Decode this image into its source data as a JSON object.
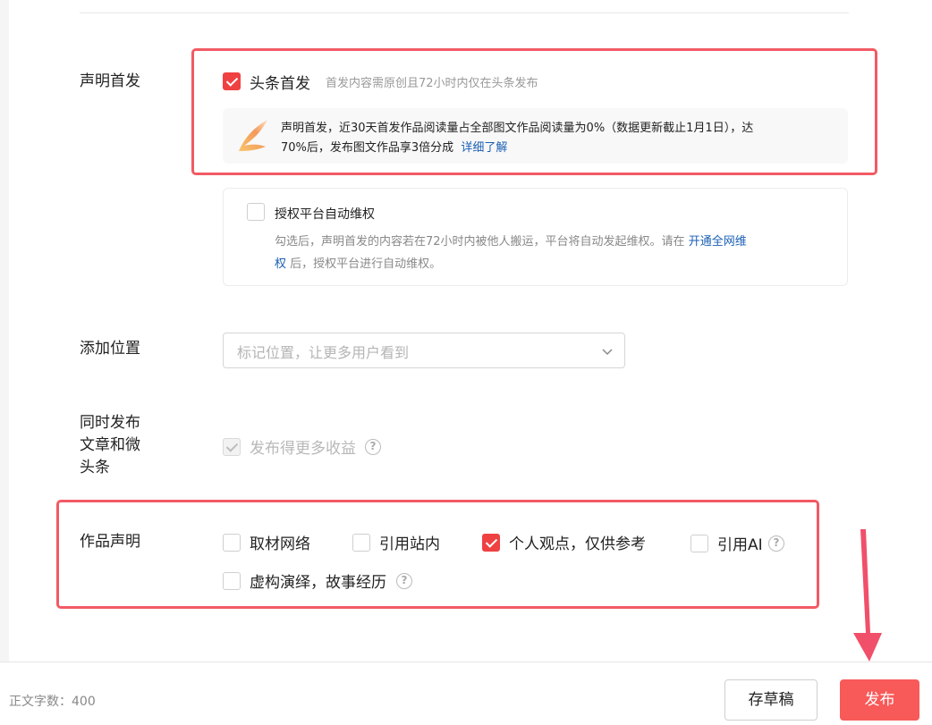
{
  "first_publish": {
    "label": "声明首发",
    "checkbox_label": "头条首发",
    "checkbox_hint": "首发内容需原创且72小时内仅在头条发布",
    "checked": true,
    "notice_line1": "声明首发，近30天首发作品阅读量占全部图文作品阅读量为0%（数据更新截止1月1日），达",
    "notice_line2": "70%后，发布图文作品享3倍分成",
    "notice_link": "详细了解"
  },
  "auth_rights": {
    "title": "授权平台自动维权",
    "checked": false,
    "desc_line1": "勾选后，声明首发的内容若在72小时内被他人搬运，平台将自动发起维权。请在",
    "link_part1": "开通全网维",
    "link_part2": "权",
    "desc_line2": "后，授权平台进行自动维权。"
  },
  "location": {
    "label": "添加位置",
    "placeholder": "标记位置，让更多用户看到",
    "dropdown_icon": "chevron-down-icon"
  },
  "sync_publish": {
    "label_line1": "同时发布",
    "label_line2": "文章和微",
    "label_line3": "头条",
    "checkbox_label": "发布得更多收益",
    "checked": true,
    "disabled": true
  },
  "declaration": {
    "label": "作品声明",
    "options": [
      {
        "label": "取材网络",
        "checked": false
      },
      {
        "label": "引用站内",
        "checked": false
      },
      {
        "label": "个人观点，仅供参考",
        "checked": true
      },
      {
        "label": "引用AI",
        "checked": false,
        "help": true
      },
      {
        "label": "虚构演绎，故事经历",
        "checked": false,
        "help": true
      }
    ]
  },
  "footer": {
    "word_count": "正文字数：400",
    "draft_button": "存草稿",
    "publish_button": "发布"
  },
  "colors": {
    "accent": "#f04142",
    "highlight_box": "#f25a64",
    "publish_button": "#f85959",
    "link": "#1a5fb4"
  }
}
